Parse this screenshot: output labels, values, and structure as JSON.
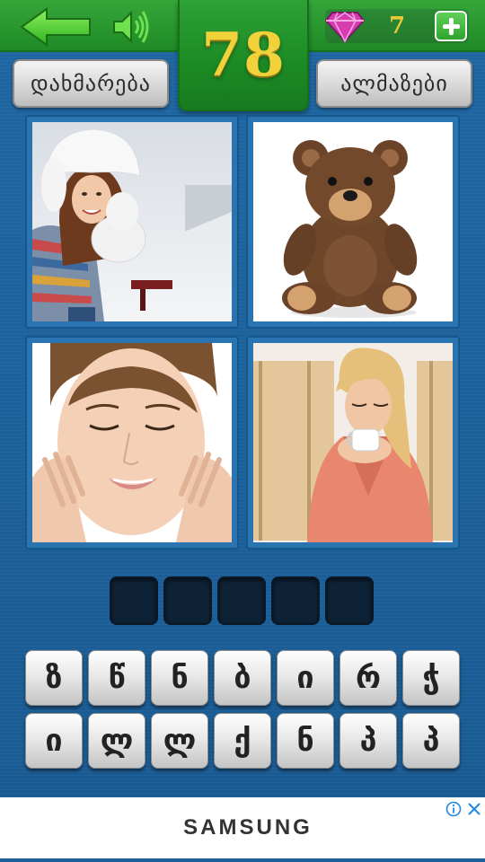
{
  "header": {
    "level": "78",
    "gem_count": "7",
    "icons": {
      "back": "arrow-left-icon",
      "sound": "speaker-icon",
      "gem": "diamond-icon",
      "add": "plus-icon"
    }
  },
  "buttons": {
    "hint_label": "დახმარება",
    "gems_label": "ალმაზები"
  },
  "pictures": [
    {
      "subject": "woman in winter hat in snow"
    },
    {
      "subject": "teddy bear"
    },
    {
      "subject": "woman touching her face"
    },
    {
      "subject": "woman in bathrobe with cup"
    }
  ],
  "answer": {
    "slots": [
      "",
      "",
      "",
      "",
      ""
    ]
  },
  "keyboard": {
    "row1": [
      "ზ",
      "წ",
      "ნ",
      "ბ",
      "ი",
      "რ",
      "ჭ"
    ],
    "row2": [
      "ი",
      "ლ",
      "ლ",
      "ქ",
      "ნ",
      "პ",
      "პ"
    ]
  },
  "ad": {
    "brand": "SAMSUNG"
  },
  "colors": {
    "background": "#1d5f98",
    "topbar": "#2a9a31",
    "level_text": "#f1d23a",
    "gem": "#d63bb0"
  }
}
